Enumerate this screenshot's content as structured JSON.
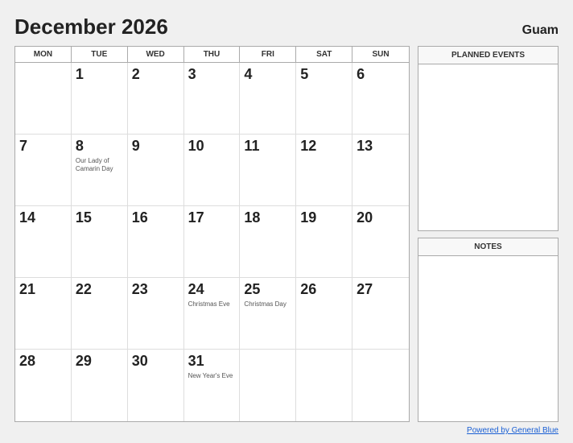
{
  "header": {
    "title": "December 2026",
    "region": "Guam"
  },
  "day_headers": [
    "MON",
    "TUE",
    "WED",
    "THU",
    "FRI",
    "SAT",
    "SUN"
  ],
  "weeks": [
    [
      {
        "num": "",
        "event": "",
        "empty": true
      },
      {
        "num": "1",
        "event": "",
        "empty": false
      },
      {
        "num": "2",
        "event": "",
        "empty": false
      },
      {
        "num": "3",
        "event": "",
        "empty": false
      },
      {
        "num": "4",
        "event": "",
        "empty": false
      },
      {
        "num": "5",
        "event": "",
        "empty": false
      },
      {
        "num": "6",
        "event": "",
        "empty": false
      }
    ],
    [
      {
        "num": "7",
        "event": "",
        "empty": false
      },
      {
        "num": "8",
        "event": "Our Lady of Camarin Day",
        "empty": false
      },
      {
        "num": "9",
        "event": "",
        "empty": false
      },
      {
        "num": "10",
        "event": "",
        "empty": false
      },
      {
        "num": "11",
        "event": "",
        "empty": false
      },
      {
        "num": "12",
        "event": "",
        "empty": false
      },
      {
        "num": "13",
        "event": "",
        "empty": false
      }
    ],
    [
      {
        "num": "14",
        "event": "",
        "empty": false
      },
      {
        "num": "15",
        "event": "",
        "empty": false
      },
      {
        "num": "16",
        "event": "",
        "empty": false
      },
      {
        "num": "17",
        "event": "",
        "empty": false
      },
      {
        "num": "18",
        "event": "",
        "empty": false
      },
      {
        "num": "19",
        "event": "",
        "empty": false
      },
      {
        "num": "20",
        "event": "",
        "empty": false
      }
    ],
    [
      {
        "num": "21",
        "event": "",
        "empty": false
      },
      {
        "num": "22",
        "event": "",
        "empty": false
      },
      {
        "num": "23",
        "event": "",
        "empty": false
      },
      {
        "num": "24",
        "event": "Christmas Eve",
        "empty": false
      },
      {
        "num": "25",
        "event": "Christmas Day",
        "empty": false
      },
      {
        "num": "26",
        "event": "",
        "empty": false
      },
      {
        "num": "27",
        "event": "",
        "empty": false
      }
    ],
    [
      {
        "num": "28",
        "event": "",
        "empty": false
      },
      {
        "num": "29",
        "event": "",
        "empty": false
      },
      {
        "num": "30",
        "event": "",
        "empty": false
      },
      {
        "num": "31",
        "event": "New Year's Eve",
        "empty": false
      },
      {
        "num": "",
        "event": "",
        "empty": true
      },
      {
        "num": "",
        "event": "",
        "empty": true
      },
      {
        "num": "",
        "event": "",
        "empty": true
      }
    ]
  ],
  "sidebar": {
    "planned_events_label": "PLANNED EVENTS",
    "notes_label": "NOTES"
  },
  "footer": {
    "link_text": "Powered by General Blue"
  }
}
